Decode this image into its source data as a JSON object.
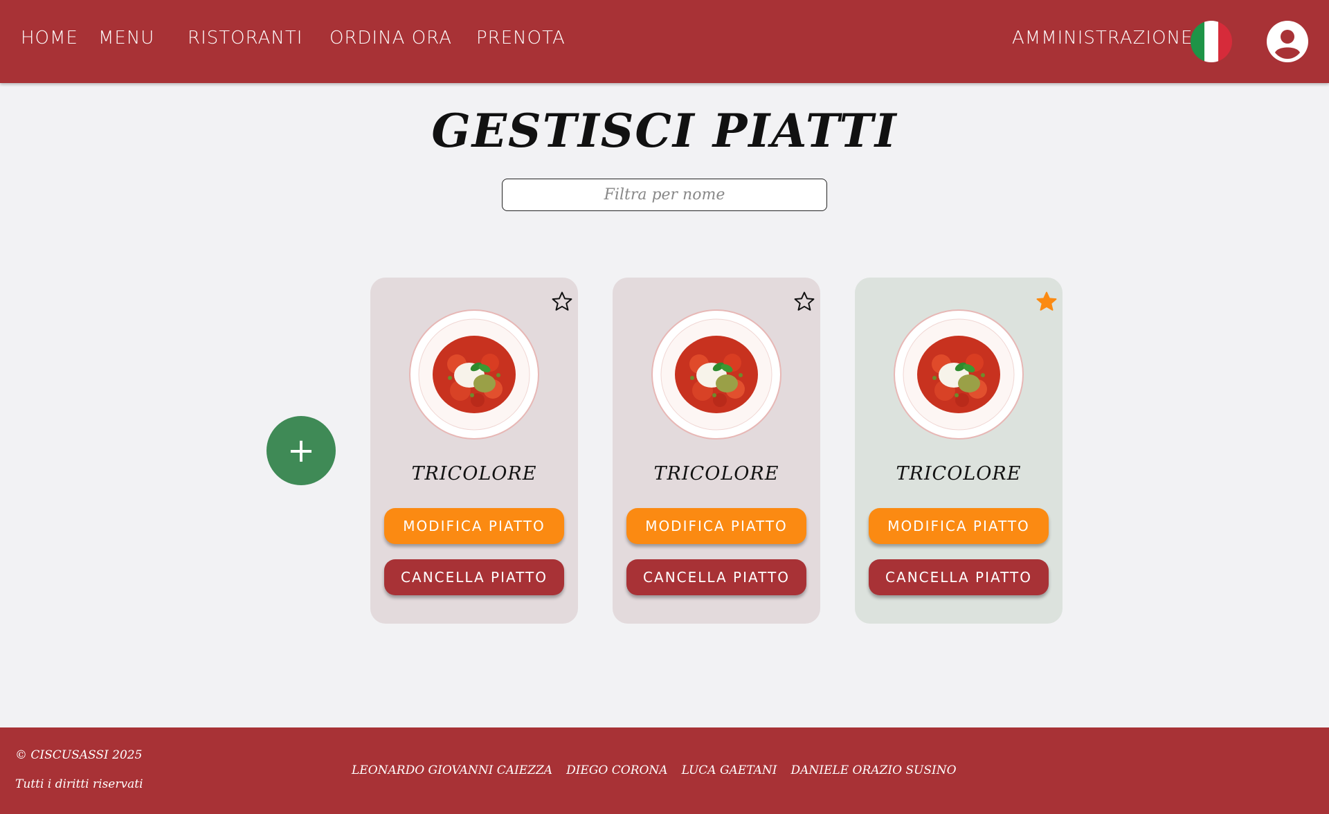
{
  "nav": {
    "home": "HOME",
    "menu": "MENU",
    "ristoranti": "RISTORANTI",
    "ordina": "ORDINA ORA",
    "prenota": "PRENOTA",
    "admin": "AMMINISTRAZIONE",
    "language_icon": "italian-flag-icon",
    "user_icon": "user-account-icon"
  },
  "main": {
    "title": "GESTISCI PIATTI",
    "filter_placeholder": "Filtra per nome",
    "add_label": "+"
  },
  "dishes": [
    {
      "name": "TRICOLORE",
      "favorite": false,
      "edit_label": "MODIFICA PIATTO",
      "delete_label": "CANCELLA PIATTO",
      "bg": "#e3dadc"
    },
    {
      "name": "TRICOLORE",
      "favorite": false,
      "edit_label": "MODIFICA PIATTO",
      "delete_label": "CANCELLA PIATTO",
      "bg": "#e3dadc"
    },
    {
      "name": "TRICOLORE",
      "favorite": true,
      "edit_label": "MODIFICA PIATTO",
      "delete_label": "CANCELLA PIATTO",
      "bg": "#dce2dd"
    }
  ],
  "footer": {
    "copyright": "© CISCUSASSI 2025",
    "rights": "Tutti i diritti riservati",
    "authors": [
      "LEONARDO GIOVANNI CAIEZZA",
      "DIEGO CORONA",
      "LUCA GAETANI",
      "DANIELE ORAZIO SUSINO"
    ]
  },
  "colors": {
    "brand_red": "#a83236",
    "accent_orange": "#fb8a12",
    "add_green": "#3f8a56",
    "favorite_star": "#fb8a12"
  }
}
